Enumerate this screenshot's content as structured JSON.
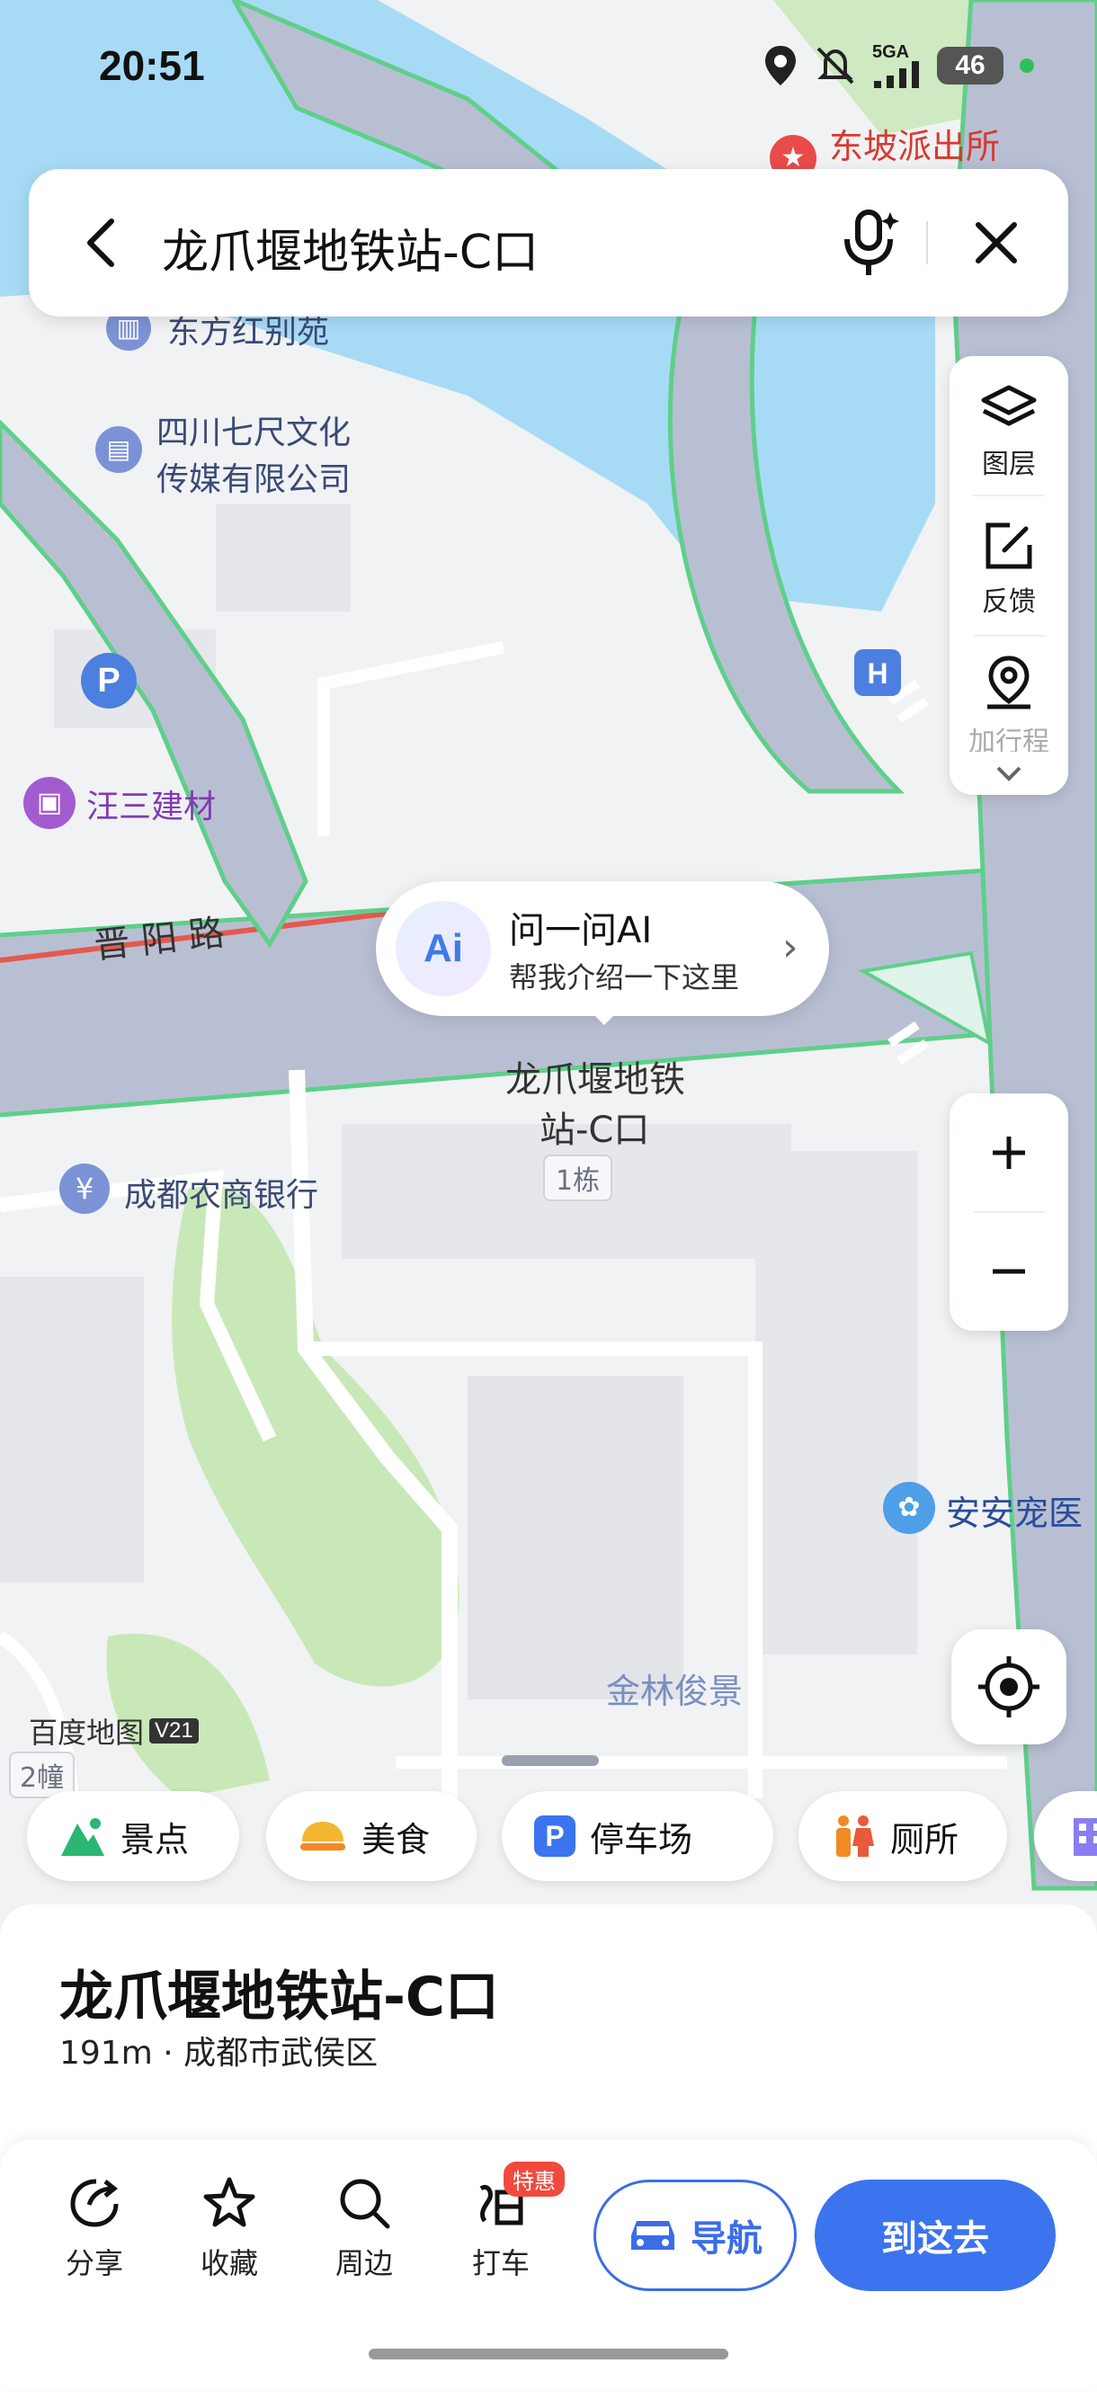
{
  "status": {
    "time": "20:51",
    "network": "5GA",
    "battery": "46"
  },
  "search": {
    "query": "龙爪堰地铁站-C口"
  },
  "tools": [
    {
      "label": "图层",
      "icon": "layers-icon"
    },
    {
      "label": "反馈",
      "icon": "feedback-edit-icon"
    },
    {
      "label": "加行程",
      "icon": "location-pin-icon"
    }
  ],
  "ai": {
    "title": "问一问AI",
    "subtitle": "帮我介绍一下这里",
    "badge": "Ai"
  },
  "map": {
    "pois": {
      "police": "东坡派出所",
      "villa": "东方红别苑",
      "culture": "四川七尺文化传媒有限公司",
      "culture_line1": "四川七尺文化",
      "culture_line2": "传媒有限公司",
      "building": "汪三建材",
      "road": "晋 阳 路",
      "bank": "成都农商银行",
      "pet": "安安宠医",
      "community": "金林俊景",
      "station_line1": "龙爪堰地铁",
      "station_line2": "站-C口",
      "building1": "1栋",
      "building2": "2幢",
      "watermark": "百度地图",
      "watermark_ver": "V21"
    }
  },
  "chips": [
    {
      "label": "景点",
      "icon": "scenic-icon"
    },
    {
      "label": "美食",
      "icon": "food-icon"
    },
    {
      "label": "停车场",
      "icon": "parking-icon"
    },
    {
      "label": "厕所",
      "icon": "toilet-icon"
    }
  ],
  "place": {
    "name": "龙爪堰地铁站-C口",
    "distance": "191m",
    "separator": "·",
    "district": "成都市武侯区"
  },
  "actions": [
    {
      "label": "分享",
      "icon": "share-icon"
    },
    {
      "label": "收藏",
      "icon": "star-icon"
    },
    {
      "label": "周边",
      "icon": "search-icon"
    },
    {
      "label": "打车",
      "icon": "taxi-icon"
    }
  ],
  "taxi_tag": "特惠",
  "nav_label": "导航",
  "go_label": "到这去",
  "colors": {
    "accent": "#3b74ee",
    "water": "#a7dbf5",
    "green": "#c9e8b8",
    "road": "#b9bfd3"
  }
}
